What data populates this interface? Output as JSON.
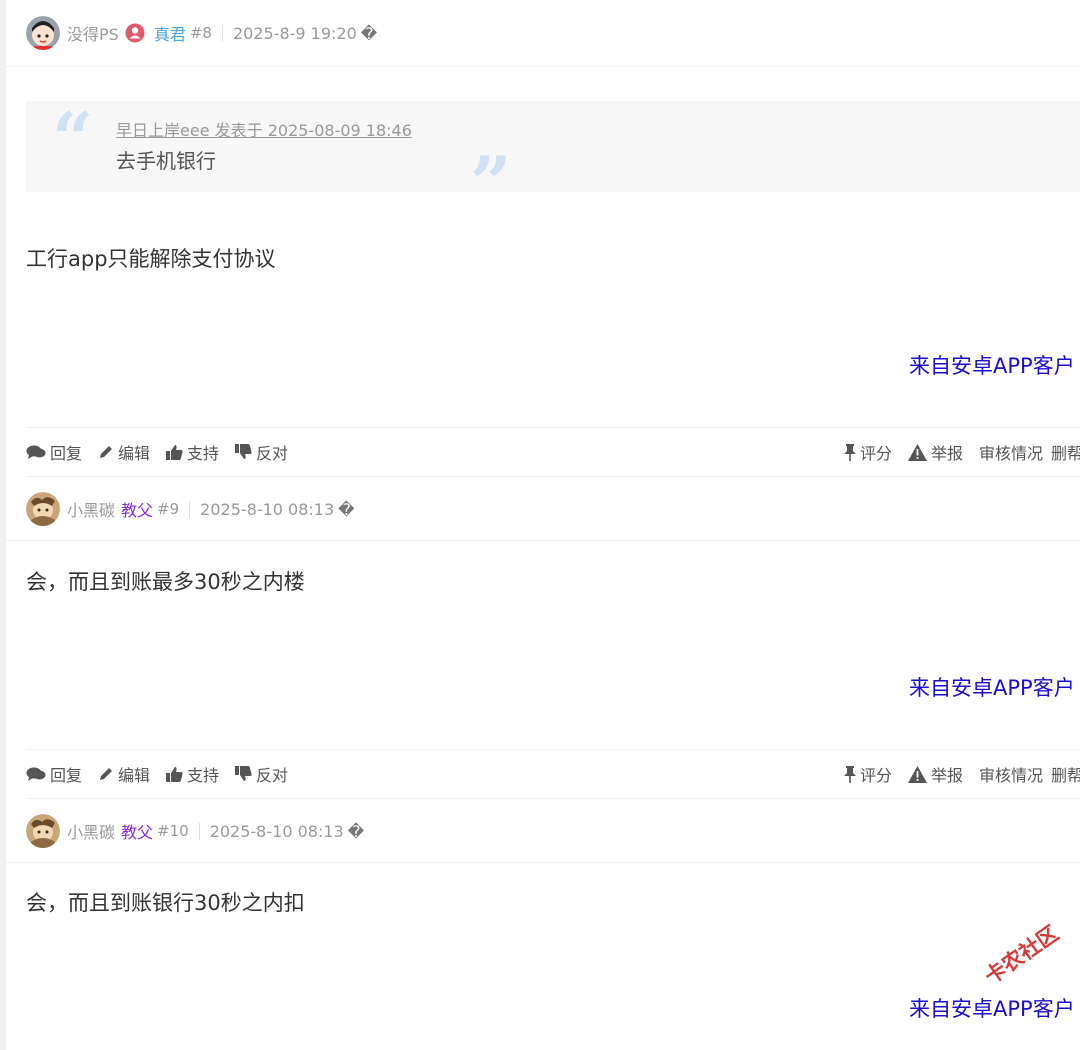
{
  "posts": [
    {
      "username": "没得PS",
      "rank": "真君",
      "floor": "#8",
      "time": "2025-8-9 19:20",
      "menu_glyph": "�",
      "quote": {
        "meta": "早日上岸eee 发表于 2025-08-09 18:46",
        "text": "去手机银行"
      },
      "content": "工行app只能解除支付协议",
      "from_app": "来自安卓APP客户"
    },
    {
      "username": "小黑碳",
      "rank": "教父",
      "floor": "#9",
      "time": "2025-8-10 08:13",
      "menu_glyph": "�",
      "content": "会，而且到账最多30秒之内楼",
      "from_app": "来自安卓APP客户"
    },
    {
      "username": "小黑碳",
      "rank": "教父",
      "floor": "#10",
      "time": "2025-8-10 08:13",
      "menu_glyph": "�",
      "content": "会，而且到账银行30秒之内扣",
      "from_app": "来自安卓APP客户"
    }
  ],
  "actions": {
    "reply": "回复",
    "edit": "编辑",
    "support": "支持",
    "oppose": "反对",
    "rate": "评分",
    "report": "举报",
    "review": "审核情况",
    "delete": "删帮"
  },
  "watermark": "卡农社区",
  "colors": {
    "rank_zhenjun": "#4aa3df",
    "rank_jiaofu": "#8a2be2",
    "from_app_link": "#1a0dcc",
    "quote_mark": "#cfe1f2"
  }
}
